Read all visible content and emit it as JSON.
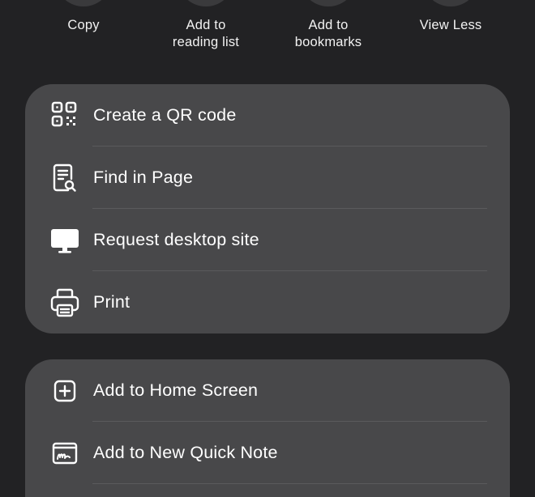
{
  "share_actions": [
    {
      "label": "Copy",
      "icon": "copy-icon"
    },
    {
      "label": "Add to\nreading list",
      "icon": "reading-list-icon"
    },
    {
      "label": "Add to\nbookmarks",
      "icon": "bookmark-icon"
    },
    {
      "label": "View Less",
      "icon": "chevron-up-icon"
    }
  ],
  "menu_group_1": [
    {
      "label": "Create a QR code",
      "icon": "qr-code-icon"
    },
    {
      "label": "Find in Page",
      "icon": "find-in-page-icon"
    },
    {
      "label": "Request desktop site",
      "icon": "desktop-icon"
    },
    {
      "label": "Print",
      "icon": "printer-icon"
    }
  ],
  "menu_group_2": [
    {
      "label": "Add to Home Screen",
      "icon": "add-square-icon"
    },
    {
      "label": "Add to New Quick Note",
      "icon": "quick-note-icon"
    }
  ],
  "colors": {
    "background": "#222224",
    "card": "#48484a",
    "divider": "#5a5a5c",
    "text": "#ffffff"
  }
}
